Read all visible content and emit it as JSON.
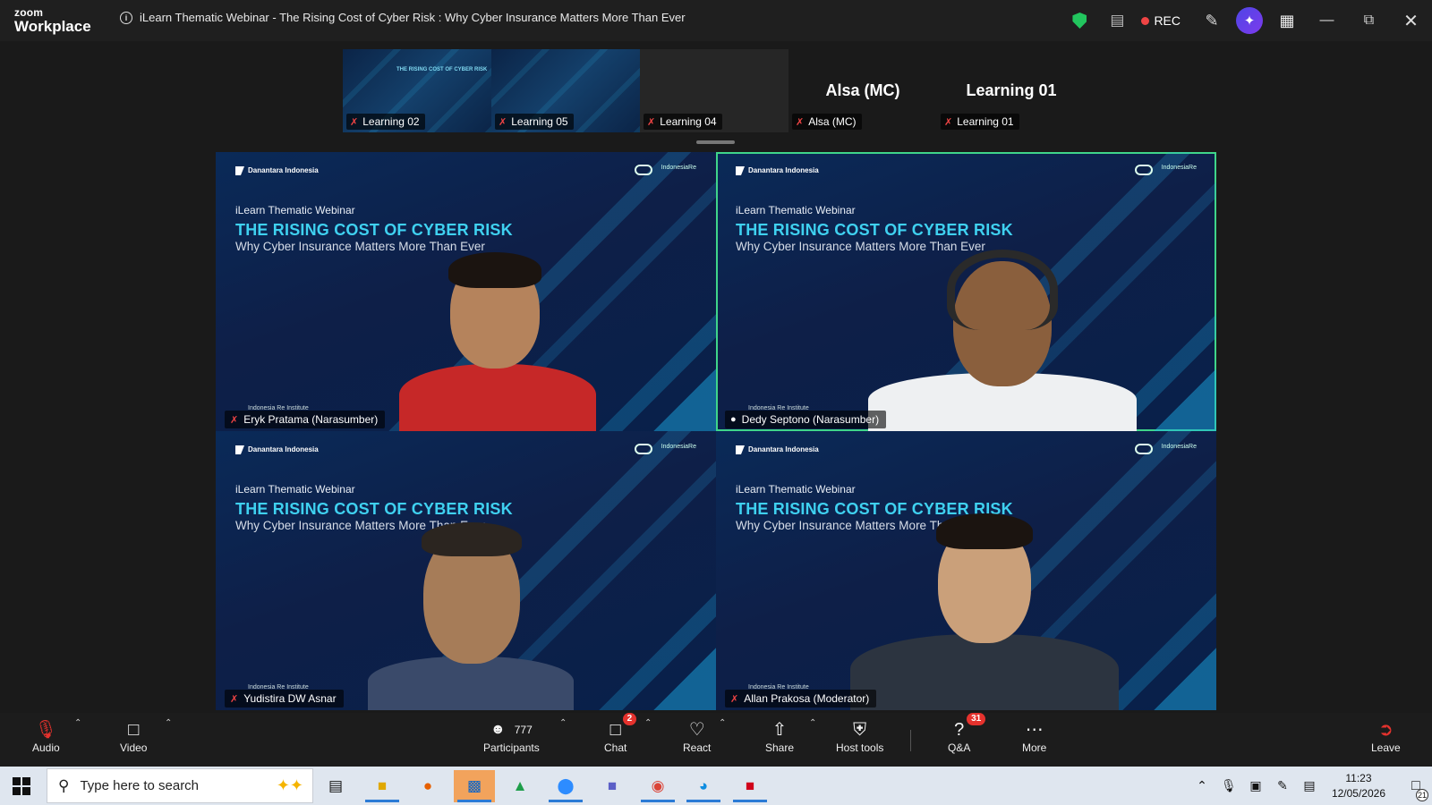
{
  "app": {
    "logo_top": "zoom",
    "logo_bottom": "Workplace"
  },
  "meeting": {
    "title": "iLearn Thematic Webinar - The Rising Cost of Cyber Risk : Why Cyber Insurance Matters More Than Ever",
    "rec_label": "REC"
  },
  "colors": {
    "accent_green": "#3fd58a",
    "rec_red": "#ef4444",
    "slide_cyan": "#3fd1f0",
    "badge_red": "#e5322d"
  },
  "thumbnails": [
    {
      "name": "Learning 02",
      "muted": true,
      "view": "slide"
    },
    {
      "name": "Learning 05",
      "muted": true,
      "view": "slide"
    },
    {
      "name": "Learning 04",
      "muted": true,
      "view": "blank"
    },
    {
      "name": "Alsa (MC)",
      "muted": true,
      "view": "name",
      "display": "Alsa (MC)"
    },
    {
      "name": "Learning 01",
      "muted": true,
      "view": "name",
      "display": "Learning 01"
    }
  ],
  "slide": {
    "brand_left": "Danantara Indonesia",
    "brand_right": "IndonesiaRe",
    "kicker": "iLearn Thematic Webinar",
    "title": "THE RISING COST OF CYBER RISK",
    "subtitle": "Why Cyber Insurance Matters More Than Ever",
    "institute": "Indonesia Re Institute"
  },
  "participants": [
    {
      "name": "Eryk Pratama (Narasumber)",
      "muted": true,
      "active": false
    },
    {
      "name": "Dedy Septono (Narasumber)",
      "muted": false,
      "active": true
    },
    {
      "name": "Yudistira DW Asnar",
      "muted": true,
      "active": false
    },
    {
      "name": "Allan Prakosa (Moderator)",
      "muted": true,
      "active": false
    }
  ],
  "toolbar": {
    "audio": "Audio",
    "video": "Video",
    "participants": "Participants",
    "participants_count": "777",
    "chat": "Chat",
    "chat_badge": "2",
    "react": "React",
    "share": "Share",
    "host_tools": "Host tools",
    "qa": "Q&A",
    "qa_badge": "31",
    "more": "More",
    "leave": "Leave"
  },
  "taskbar": {
    "search_placeholder": "Type here to search",
    "time": "11:23",
    "date": "12/05/2026",
    "notifications": "21"
  }
}
